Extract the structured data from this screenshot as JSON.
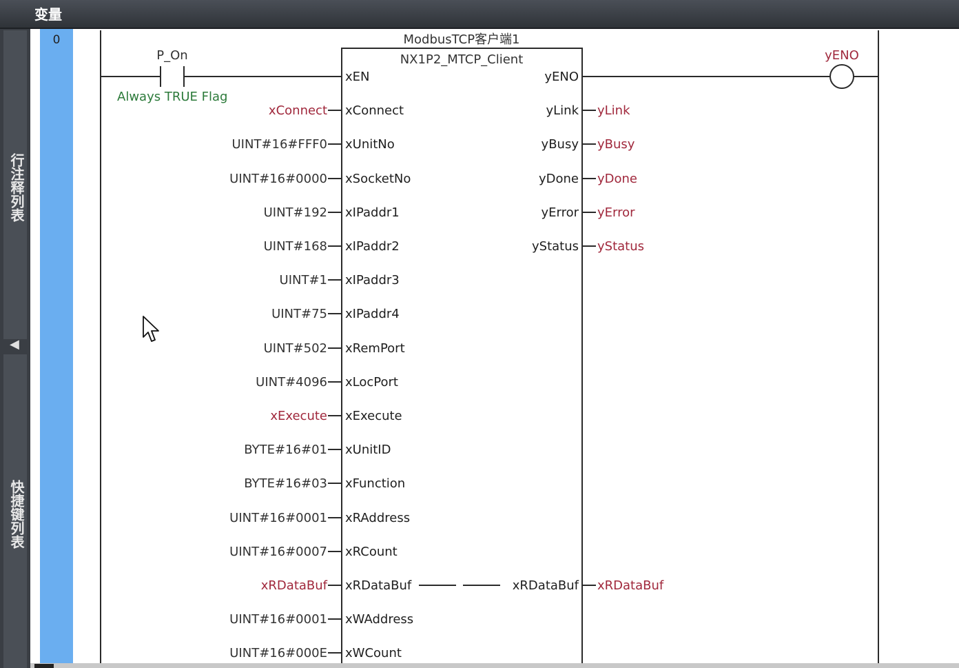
{
  "window": {
    "title": "变量"
  },
  "side_tabs": {
    "row_comments": "行注释列表",
    "shortcuts": "快捷键列表",
    "collapse_glyph": "◀"
  },
  "rung": {
    "number": "0"
  },
  "contact": {
    "variable": "P_On",
    "comment": "Always TRUE Flag"
  },
  "coil": {
    "variable": "yENO"
  },
  "function_block": {
    "instance": "ModbusTCP客户端1",
    "type": "NX1P2_MTCP_Client",
    "inputs": [
      {
        "pin": "xEN",
        "arg": "",
        "kind": "none"
      },
      {
        "pin": "xConnect",
        "arg": "xConnect",
        "kind": "var"
      },
      {
        "pin": "xUnitNo",
        "arg": "UINT#16#FFF0",
        "kind": "const"
      },
      {
        "pin": "xSocketNo",
        "arg": "UINT#16#0000",
        "kind": "const"
      },
      {
        "pin": "xIPaddr1",
        "arg": "UINT#192",
        "kind": "const"
      },
      {
        "pin": "xIPaddr2",
        "arg": "UINT#168",
        "kind": "const"
      },
      {
        "pin": "xIPaddr3",
        "arg": "UINT#1",
        "kind": "const"
      },
      {
        "pin": "xIPaddr4",
        "arg": "UINT#75",
        "kind": "const"
      },
      {
        "pin": "xRemPort",
        "arg": "UINT#502",
        "kind": "const"
      },
      {
        "pin": "xLocPort",
        "arg": "UINT#4096",
        "kind": "const"
      },
      {
        "pin": "xExecute",
        "arg": "xExecute",
        "kind": "var"
      },
      {
        "pin": "xUnitID",
        "arg": "BYTE#16#01",
        "kind": "const"
      },
      {
        "pin": "xFunction",
        "arg": "BYTE#16#03",
        "kind": "const"
      },
      {
        "pin": "xRAddress",
        "arg": "UINT#16#0001",
        "kind": "const"
      },
      {
        "pin": "xRCount",
        "arg": "UINT#16#0007",
        "kind": "const"
      },
      {
        "pin": "xRDataBuf",
        "arg": "xRDataBuf",
        "kind": "var"
      },
      {
        "pin": "xWAddress",
        "arg": "UINT#16#0001",
        "kind": "const"
      },
      {
        "pin": "xWCount",
        "arg": "UINT#16#000E",
        "kind": "const"
      }
    ],
    "outputs": [
      {
        "pin": "yENO",
        "arg": ""
      },
      {
        "pin": "yLink",
        "arg": "yLink"
      },
      {
        "pin": "yBusy",
        "arg": "yBusy"
      },
      {
        "pin": "yDone",
        "arg": "yDone"
      },
      {
        "pin": "yError",
        "arg": "yError"
      },
      {
        "pin": "yStatus",
        "arg": "yStatus"
      }
    ],
    "inout": {
      "pin": "xRDataBuf",
      "arg": "xRDataBuf"
    }
  },
  "colors": {
    "rung_column": "#6aaef0",
    "variable_text": "#a0283c",
    "comment_text": "#2c7a3a",
    "titlebar": "#3a3e44"
  }
}
